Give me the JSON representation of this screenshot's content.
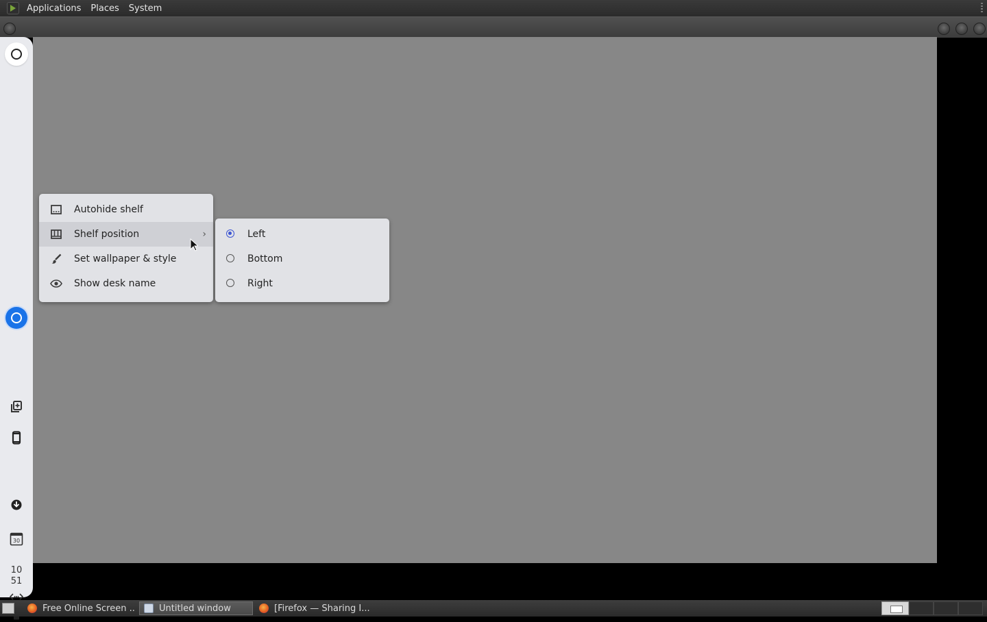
{
  "topbar": {
    "menus": [
      "Applications",
      "Places",
      "System"
    ]
  },
  "shelf": {
    "clock": {
      "hour": "10",
      "minute": "51"
    },
    "icons": [
      "launcher-icon",
      "chrome-icon",
      "copy-icon",
      "phone-icon",
      "download-icon",
      "calendar-icon",
      "network-icon",
      "battery-icon"
    ],
    "calendar_day": "30"
  },
  "context_menu": {
    "items": [
      {
        "label": "Autohide shelf",
        "icon": "autohide-icon"
      },
      {
        "label": "Shelf position",
        "icon": "shelf-position-icon",
        "has_submenu": true
      },
      {
        "label": "Set wallpaper & style",
        "icon": "brush-icon"
      },
      {
        "label": "Show desk name",
        "icon": "eye-icon"
      }
    ]
  },
  "submenu": {
    "options": [
      {
        "label": "Left",
        "selected": true
      },
      {
        "label": "Bottom",
        "selected": false
      },
      {
        "label": "Right",
        "selected": false
      }
    ]
  },
  "taskbar": {
    "tasks": [
      {
        "label": "Free Online Screen ...",
        "icon": "firefox-icon"
      },
      {
        "label": "Untitled window",
        "icon": "window-icon",
        "active": true
      },
      {
        "label": "[Firefox — Sharing I...",
        "icon": "firefox-icon"
      }
    ]
  },
  "colors": {
    "desktop": "#878787",
    "shelf": "#e9eaee",
    "menu": "#e1e2e6",
    "radio_selected": "#3c55d2",
    "chrome_blue": "#1a73e8"
  }
}
